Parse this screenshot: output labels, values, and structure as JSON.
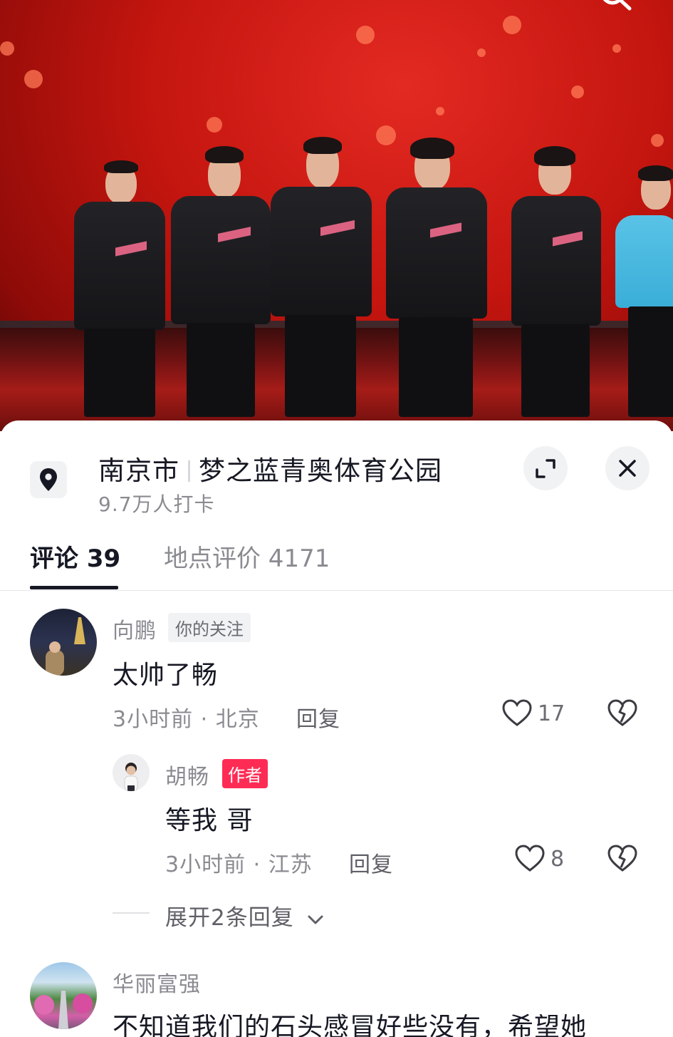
{
  "location": {
    "city": "南京市",
    "name": "梦之蓝青奥体育公园",
    "checkins": "9.7万人打卡",
    "pin_icon": "location-pin-icon"
  },
  "tabs": [
    {
      "label": "评论 39",
      "active": true
    },
    {
      "label": "地点评价 4171",
      "active": false
    }
  ],
  "comments": [
    {
      "username": "向鹏",
      "badge": "你的关注",
      "text": "太帅了畅",
      "meta": "3小时前 · 北京",
      "reply_label": "回复",
      "likes": "17",
      "replies": [
        {
          "username": "胡畅",
          "badge": "作者",
          "text": "等我 哥",
          "meta": "3小时前 · 江苏",
          "reply_label": "回复",
          "likes": "8"
        }
      ],
      "expand_label": "展开2条回复"
    },
    {
      "username": "华丽富强",
      "text": "不知道我们的石头感冒好些没有，希望她"
    }
  ],
  "colors": {
    "accent_red": "#fe2c55",
    "text_primary": "#161823",
    "text_secondary": "#8a8b91",
    "photo_red": "#c4150f"
  },
  "icons": {
    "search": "search-icon",
    "expand": "expand-icon",
    "close": "close-icon",
    "like": "heart-icon",
    "dislike": "broken-heart-icon",
    "chevron": "chevron-down-icon"
  }
}
